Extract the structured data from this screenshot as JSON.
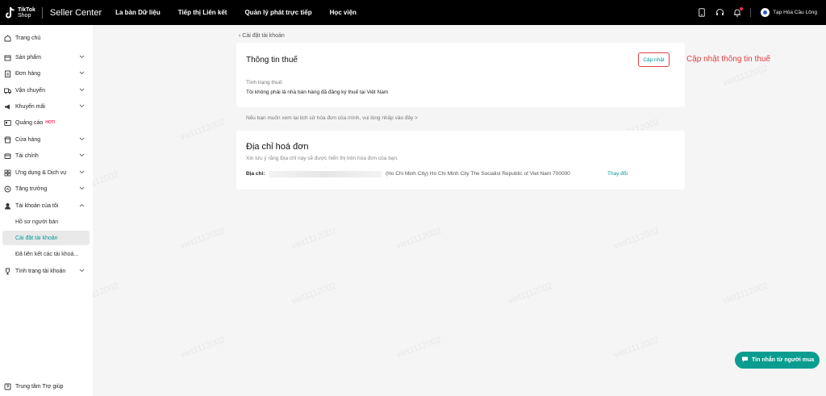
{
  "topbar": {
    "logo_line1": "TikTok",
    "logo_line2": "Shop",
    "brand": "Seller Center",
    "nav": [
      "La bàn Dữ liệu",
      "Tiếp thị Liên kết",
      "Quản lý phát trực tiếp",
      "Học viện"
    ],
    "store_name": "Tạp Hóa Cầu Lông"
  },
  "sidebar": {
    "items": [
      {
        "label": "Trang chủ",
        "icon": "home-icon"
      },
      {
        "label": "Sản phẩm",
        "icon": "box-icon"
      },
      {
        "label": "Đơn hàng",
        "icon": "clipboard-icon"
      },
      {
        "label": "Vận chuyển",
        "icon": "truck-icon"
      },
      {
        "label": "Khuyến mãi",
        "icon": "megaphone-icon"
      },
      {
        "label": "Quảng cáo",
        "icon": "ads-icon",
        "badge": "HOT!"
      },
      {
        "label": "Cửa hàng",
        "icon": "store-icon"
      },
      {
        "label": "Tài chính",
        "icon": "finance-icon"
      },
      {
        "label": "Ứng dụng & Dịch vụ",
        "icon": "apps-icon"
      },
      {
        "label": "Tăng trưởng",
        "icon": "growth-icon"
      },
      {
        "label": "Tài khoản của tôi",
        "icon": "user-icon"
      }
    ],
    "sub_items": [
      "Hồ sơ người bán",
      "Cài đặt tài khoản",
      "Đã liên kết các tài khoả..."
    ],
    "account_status": "Tình trạng tài khoản",
    "help": "Trung tâm Trợ giúp"
  },
  "main": {
    "back_label": "Cài đặt tài khoản",
    "tax": {
      "title": "Thông tin thuế",
      "update_button": "Cập nhật",
      "status_label": "Tình trạng thuế:",
      "status_value": "Tôi không phải là nhà bán hàng đã đăng ký thuế tại Việt Nam"
    },
    "annotation": "Cập nhật thông tin thuế",
    "history_link": "Nếu bạn muốn xem lại lịch sử hóa đơn của mình, vui lòng nhấp vào đây >",
    "invoice": {
      "title": "Địa chỉ hoá đơn",
      "description": "Xin lưu ý rằng Địa chỉ này sẽ được hiển thị trên hóa đơn của bạn.",
      "address_label": "Địa chỉ:",
      "address_value": "(Ho Chi Minh City) Ho Chi Minh City The Socialist Republic of Viet Nam 700000",
      "change_link": "Thay đổi"
    }
  },
  "watermark_text": "viet1112002",
  "chat_button": "Tin nhắn từ người mua",
  "colors": {
    "accent": "#009995",
    "annotation_red": "#e04141",
    "hot": "#fe2c55",
    "chat_bg": "#0a9d8f"
  }
}
